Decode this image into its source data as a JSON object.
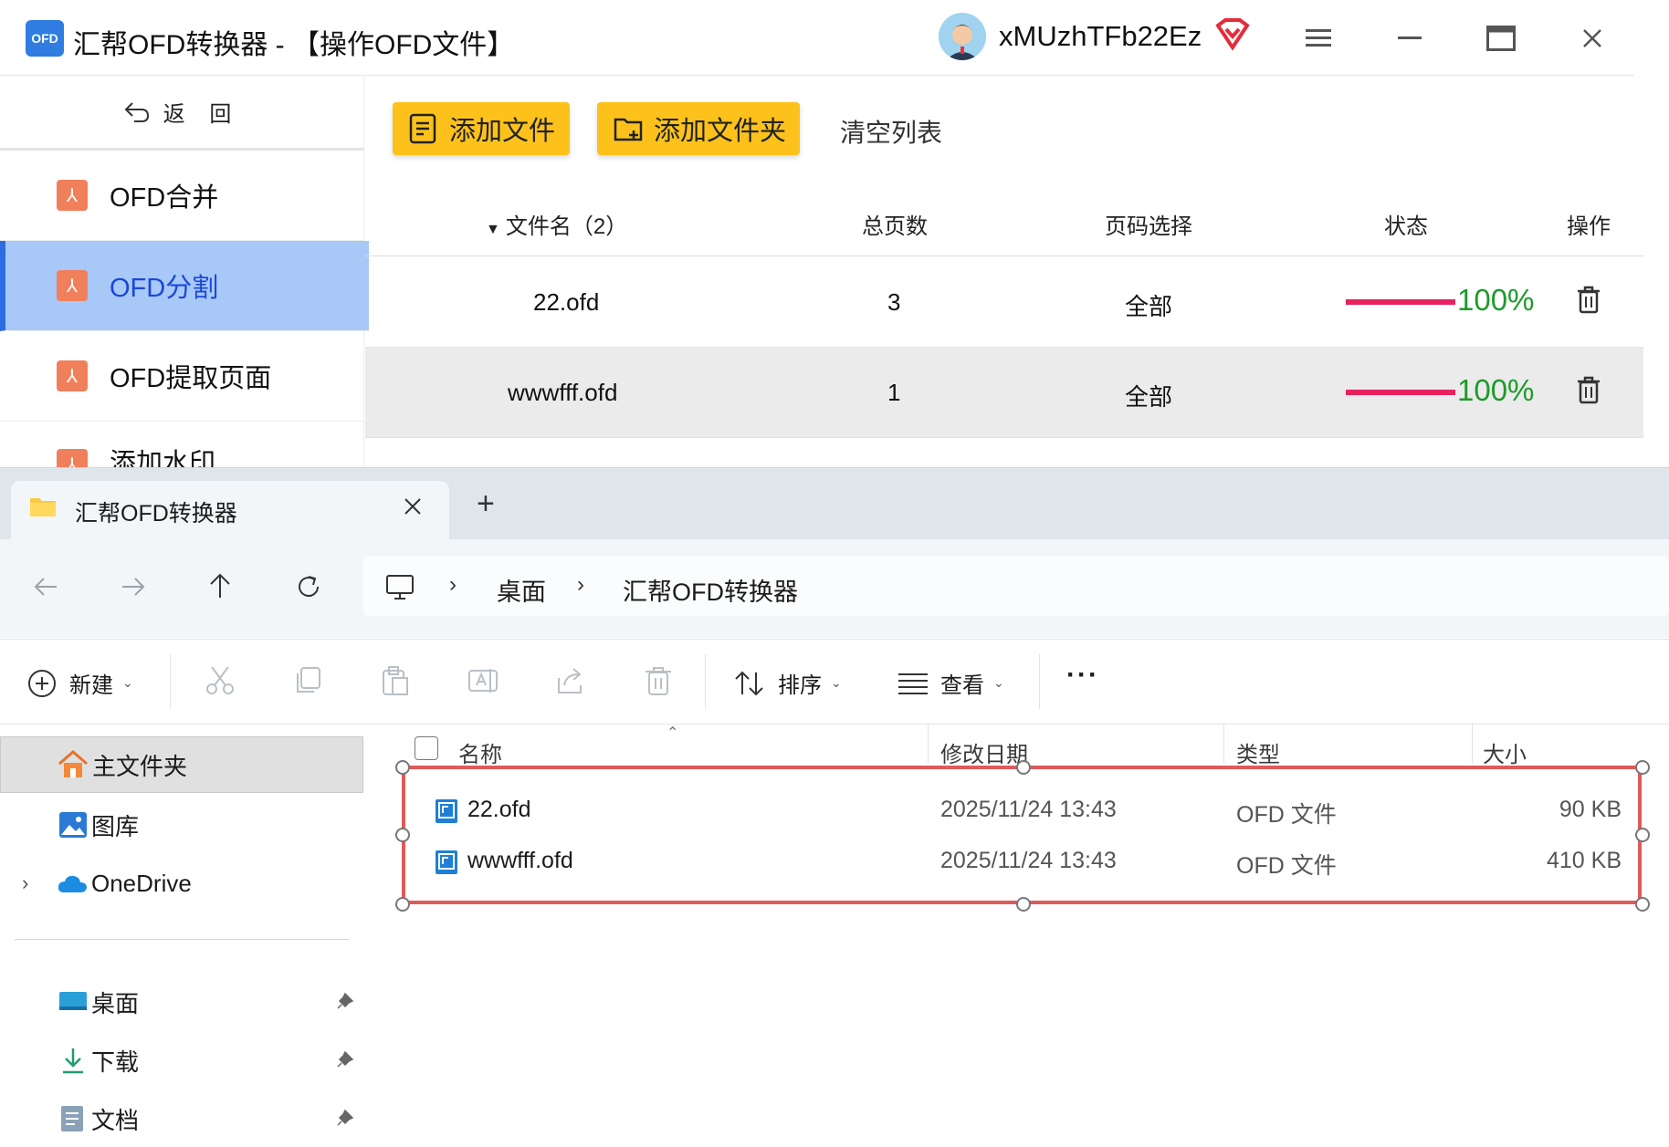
{
  "app": {
    "logo_text": "OFD",
    "title": "汇帮OFD转换器 - 【操作OFD文件】",
    "username": "xMUzhTFb22Ez",
    "icons": [
      "menu-icon",
      "minimize-icon",
      "maximize-icon",
      "close-icon",
      "vip-icon"
    ],
    "back_label": "返 回",
    "sidebar": [
      {
        "label": "OFD合并"
      },
      {
        "label": "OFD分割"
      },
      {
        "label": "OFD提取页面"
      },
      {
        "label": "添加水印"
      }
    ],
    "toolbar": {
      "add_file": "添加文件",
      "add_folder": "添加文件夹",
      "clear_list": "清空列表"
    },
    "table": {
      "headers": {
        "filename": "文件名（2）",
        "pages": "总页数",
        "page_select": "页码选择",
        "status": "状态",
        "action": "操作"
      },
      "rows": [
        {
          "filename": "22.ofd",
          "pages": "3",
          "page_select": "全部",
          "status": "100%"
        },
        {
          "filename": "wwwfff.ofd",
          "pages": "1",
          "page_select": "全部",
          "status": "100%"
        }
      ]
    },
    "colors": {
      "accent_yellow": "#fcc21b",
      "progress": "#e8215f",
      "status_green": "#1e9a2c",
      "active_bg": "#a8c8f8"
    }
  },
  "explorer": {
    "tab_title": "汇帮OFD转换器",
    "new_tab": "+",
    "breadcrumb": [
      "桌面",
      "汇帮OFD转换器"
    ],
    "commands": {
      "new": "新建",
      "sort": "排序",
      "view": "查看",
      "more": "···"
    },
    "nav": [
      {
        "label": "主文件夹"
      },
      {
        "label": "图库"
      },
      {
        "label": "OneDrive"
      },
      {
        "label": "桌面"
      },
      {
        "label": "下载"
      },
      {
        "label": "文档"
      }
    ],
    "columns": {
      "name": "名称",
      "modified": "修改日期",
      "type": "类型",
      "size": "大小"
    },
    "files": [
      {
        "name": "22.ofd",
        "modified": "2025/11/24 13:43",
        "type": "OFD 文件",
        "size": "90 KB"
      },
      {
        "name": "wwwfff.ofd",
        "modified": "2025/11/24 13:43",
        "type": "OFD 文件",
        "size": "410 KB"
      }
    ],
    "selection_color": "#e05a5a"
  }
}
